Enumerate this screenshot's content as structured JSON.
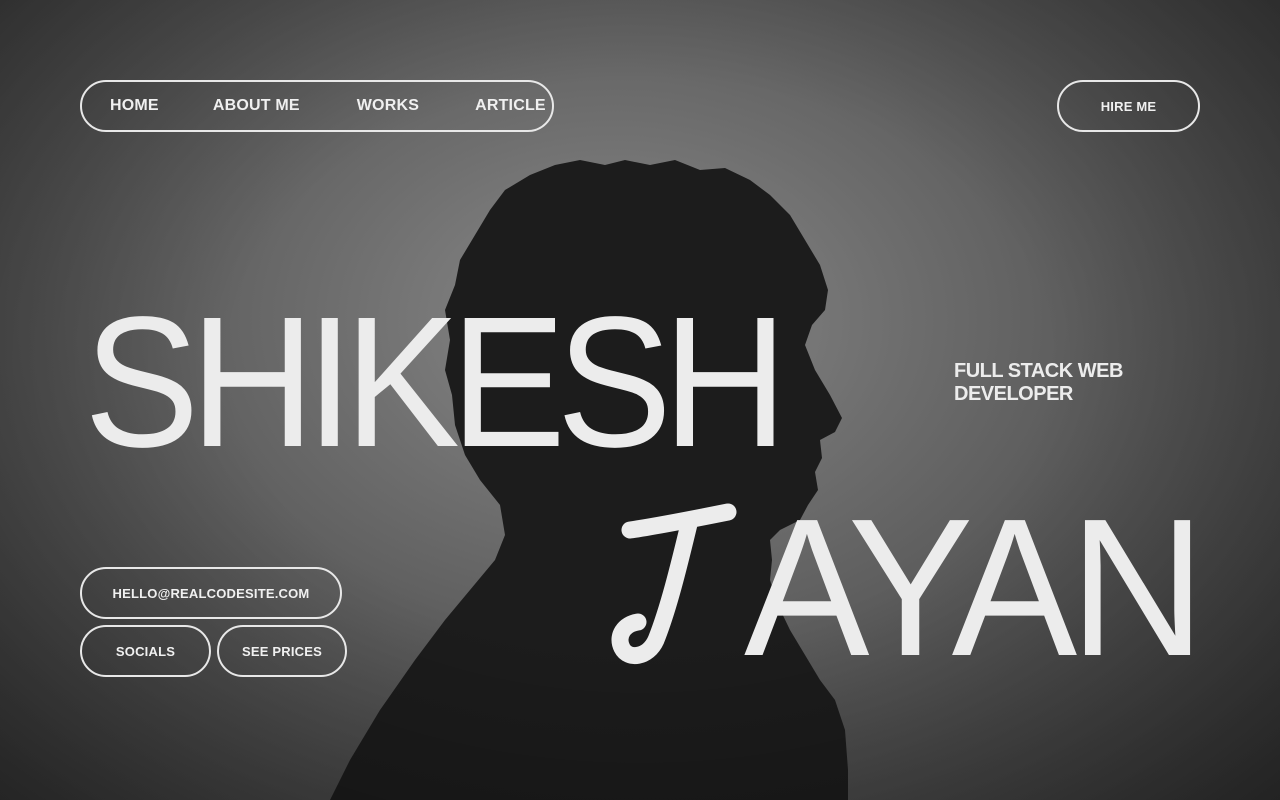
{
  "nav": {
    "items": [
      {
        "label": "HOME"
      },
      {
        "label": "ABOUT ME"
      },
      {
        "label": "WORKS"
      },
      {
        "label": "ARTICLE"
      }
    ]
  },
  "header": {
    "hire_label": "HIRE ME"
  },
  "hero": {
    "first_name": "SHIKESH",
    "last_name_initial": "J",
    "last_name_rest": "AYAN",
    "role_line1": "FULL STACK WEB",
    "role_line2": "DEVELOPER"
  },
  "contact": {
    "email_label": "HELLO@REALCODESITE.COM",
    "socials_label": "SOCIALS",
    "prices_label": "SEE PRICES"
  },
  "theme": {
    "text_color": "#ececec",
    "background": "#6e6e6e",
    "silhouette": "#1c1c1c"
  },
  "icons": [
    "portrait-silhouette"
  ]
}
